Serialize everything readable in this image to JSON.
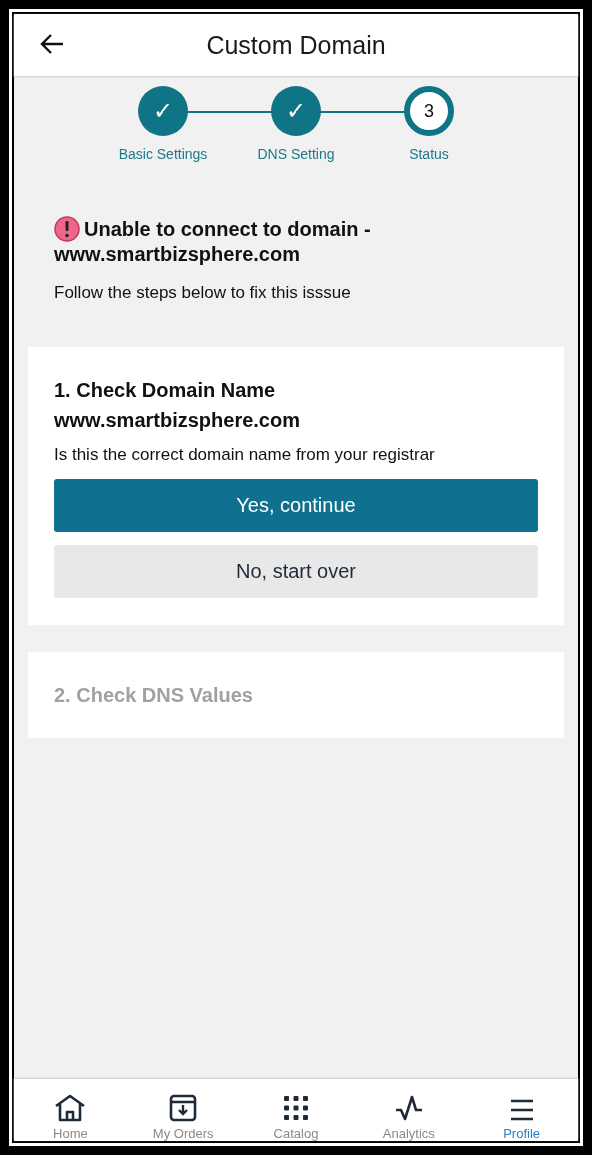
{
  "header": {
    "title": "Custom Domain"
  },
  "steps": [
    {
      "symbol": "✓",
      "label": "Basic Settings",
      "done": true
    },
    {
      "symbol": "✓",
      "label": "DNS Setting",
      "done": true
    },
    {
      "symbol": "3",
      "label": "Status",
      "done": false
    }
  ],
  "alert": {
    "title": "Unable to connect to domain -",
    "domain": "www.smartbizsphere.com",
    "message": "Follow the steps below to fix this isssue"
  },
  "cards": [
    {
      "title": "1. Check Domain Name",
      "subtitle": "www.smartbizsphere.com",
      "question": "Is this the correct domain name from your registrar",
      "disabled": false,
      "buttons": [
        {
          "label": "Yes, continue",
          "kind": "primary"
        },
        {
          "label": "No, start over",
          "kind": "secondary"
        }
      ]
    },
    {
      "title": "2. Check DNS Values",
      "disabled": true
    }
  ],
  "nav": [
    {
      "label": "Home",
      "kind": "home",
      "selected": false
    },
    {
      "label": "My Orders",
      "kind": "orders",
      "selected": false
    },
    {
      "label": "Catalog",
      "kind": "catalog",
      "selected": false
    },
    {
      "label": "Analytics",
      "kind": "analytics",
      "selected": false
    },
    {
      "label": "Profile",
      "kind": "profile",
      "selected": true
    }
  ]
}
